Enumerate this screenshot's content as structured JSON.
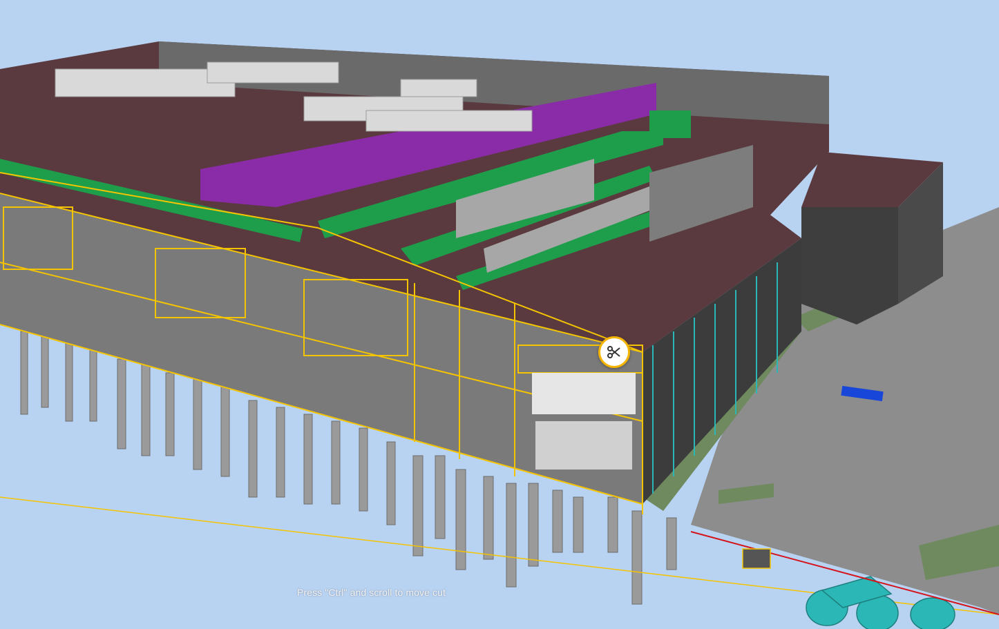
{
  "viewer": {
    "hint_text": "Press \"Ctrl\" and scroll to move cut",
    "cut_handle_icon": "scissors-icon"
  },
  "colors": {
    "sky": "#b8d2f2",
    "section_cut": "#f5c400",
    "roof": "#5a3a3e",
    "ducts": "#1e9e4a",
    "cladding": "#8a2ca8",
    "concrete": "#8e8e8e",
    "tanks": "#2bb7b5"
  }
}
